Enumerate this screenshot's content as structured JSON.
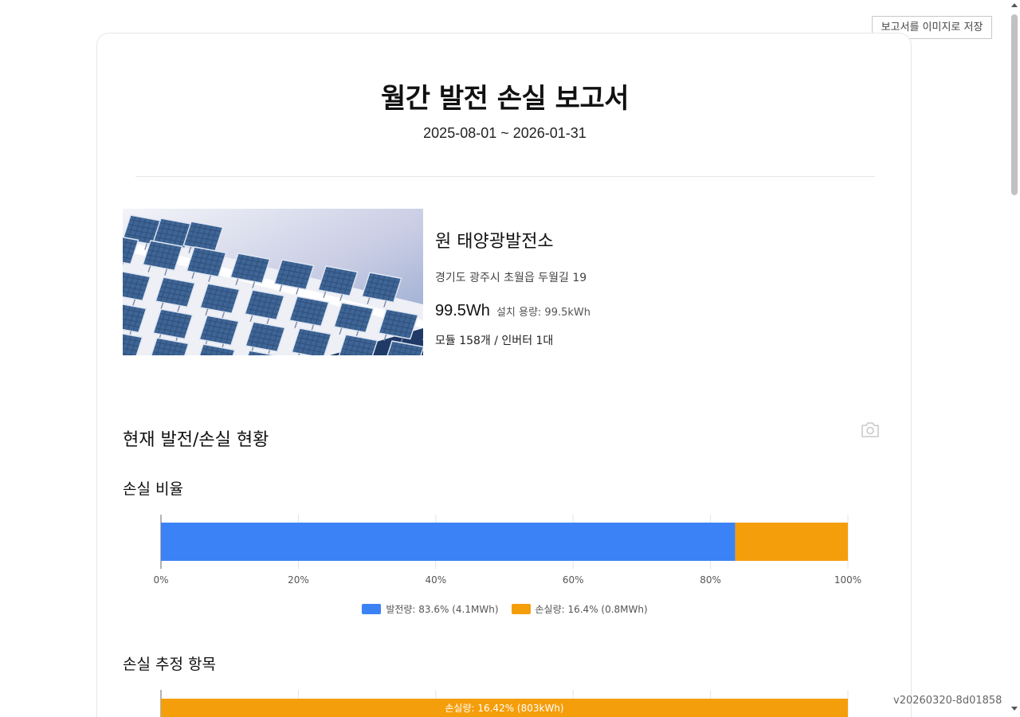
{
  "toolbar": {
    "save_label": "보고서를 이미지로 저장"
  },
  "report": {
    "title": "월간 발전 손실 보고서",
    "period": "2025-08-01 ~ 2026-01-31"
  },
  "plant": {
    "name": "원 태양광발전소",
    "address": "경기도 광주시 초월읍 두월길 19",
    "capacity": "99.5Wh",
    "installed_capacity": "설치 용량: 99.5kWh",
    "modules": "모듈 158개 / 인버터 1대"
  },
  "section": {
    "title": "현재 발전/손실 현황",
    "camera_icon": "camera-icon"
  },
  "loss_ratio": {
    "title": "손실 비율"
  },
  "loss_items": {
    "title": "손실 추정 항목"
  },
  "colors": {
    "generation": "#3b82f6",
    "loss": "#f59e0b"
  },
  "chart_data": [
    {
      "type": "bar",
      "orientation": "horizontal",
      "stacked": true,
      "title": "손실 비율",
      "xlim": [
        0,
        100
      ],
      "x_ticks": [
        "0%",
        "20%",
        "40%",
        "60%",
        "80%",
        "100%"
      ],
      "grid": true,
      "legend_position": "bottom",
      "series": [
        {
          "name": "발전량: 83.6% (4.1MWh)",
          "values": [
            83.6
          ],
          "color": "#3b82f6"
        },
        {
          "name": "손실량: 16.4% (0.8MWh)",
          "values": [
            16.4
          ],
          "color": "#f59e0b"
        }
      ]
    },
    {
      "type": "bar",
      "orientation": "horizontal",
      "stacked": true,
      "title": "손실 추정 항목",
      "xlim": [
        0,
        100
      ],
      "grid": true,
      "series": [
        {
          "name": "손실량",
          "values": [
            100
          ],
          "color": "#f59e0b",
          "label": "손실량: 16.42% (803kWh)"
        }
      ]
    }
  ],
  "version": "v20260320-8d01858"
}
